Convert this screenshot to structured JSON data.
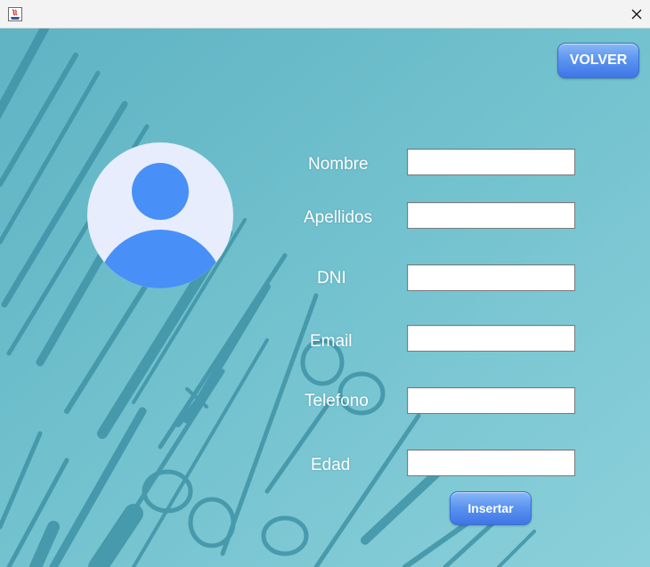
{
  "window": {
    "app_icon": "java-app-icon",
    "close_icon": "close-icon"
  },
  "header": {
    "back_button": "VOLVER"
  },
  "avatar": {
    "icon": "user-avatar-icon",
    "background_color": "#e7edfd",
    "figure_color": "#4890f7"
  },
  "form": {
    "fields": [
      {
        "label": "Nombre",
        "value": ""
      },
      {
        "label": "Apellidos",
        "value": ""
      },
      {
        "label": "DNI",
        "value": ""
      },
      {
        "label": "Email",
        "value": ""
      },
      {
        "label": "Telefono",
        "value": ""
      },
      {
        "label": "Edad",
        "value": ""
      }
    ],
    "submit_button": "Insertar"
  },
  "theme": {
    "background": "#6fbfcd",
    "button_color": "#4f86ee",
    "label_color": "#ffffff"
  }
}
